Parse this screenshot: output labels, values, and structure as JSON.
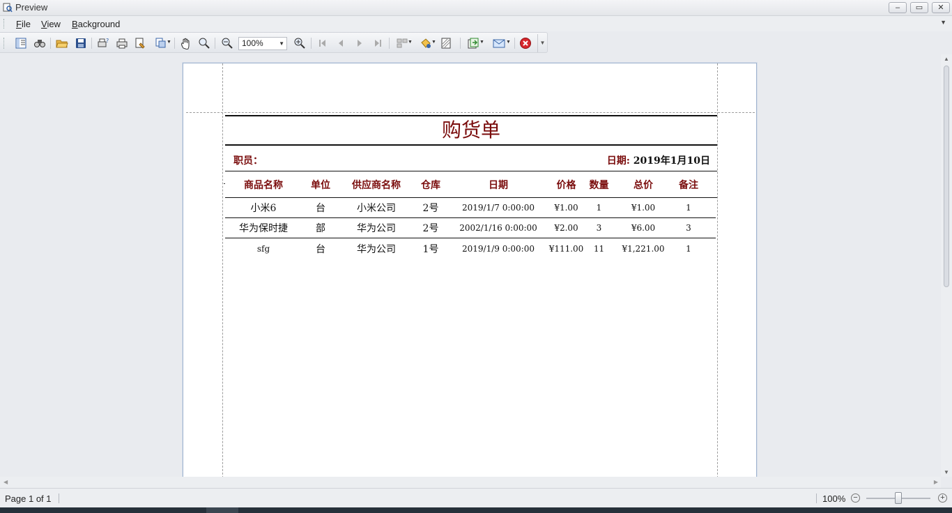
{
  "window": {
    "title": "Preview",
    "controls": {
      "minimize": "–",
      "maximize": "▭",
      "close": "✕"
    }
  },
  "menu": {
    "file": {
      "key": "F",
      "rest": "ile"
    },
    "view": {
      "key": "V",
      "rest": "iew"
    },
    "background": {
      "key": "B",
      "rest": "ackground"
    }
  },
  "toolbar": {
    "icons": [
      "document-map-icon",
      "find-icon",
      "open-icon",
      "save-icon",
      "print-dialog-icon",
      "print-icon",
      "page-setup-icon",
      "scale-icon",
      "hand-tool-icon",
      "magnifier-icon",
      "zoom-out-icon",
      "zoom-in-icon",
      "first-page-icon",
      "previous-page-icon",
      "next-page-icon",
      "last-page-icon",
      "multiple-pages-icon",
      "color-icon",
      "watermark-icon",
      "export-icon",
      "email-icon",
      "close-preview-icon"
    ],
    "zoom_value": "100%"
  },
  "report": {
    "title": "购货单",
    "clerk_label": "职员：",
    "date_label": "日期:",
    "date_value": "2019年1月10日",
    "columns": [
      "商品名称",
      "单位",
      "供应商名称",
      "仓库",
      "日期",
      "价格",
      "数量",
      "总价",
      "备注"
    ],
    "rows": [
      [
        "小米6",
        "台",
        "小米公司",
        "2号",
        "2019/1/7 0:00:00",
        "¥1.00",
        "1",
        "¥1.00",
        "1"
      ],
      [
        "华为保时捷",
        "部",
        "华为公司",
        "2号",
        "2002/1/16 0:00:00",
        "¥2.00",
        "3",
        "¥6.00",
        "3"
      ],
      [
        "sfg",
        "台",
        "华为公司",
        "1号",
        "2019/1/9 0:00:00",
        "¥111.00",
        "11",
        "¥1,221.00",
        "1"
      ]
    ]
  },
  "status": {
    "page": "Page 1 of 1",
    "zoom": "100%",
    "zoom_level_percent": 100
  }
}
